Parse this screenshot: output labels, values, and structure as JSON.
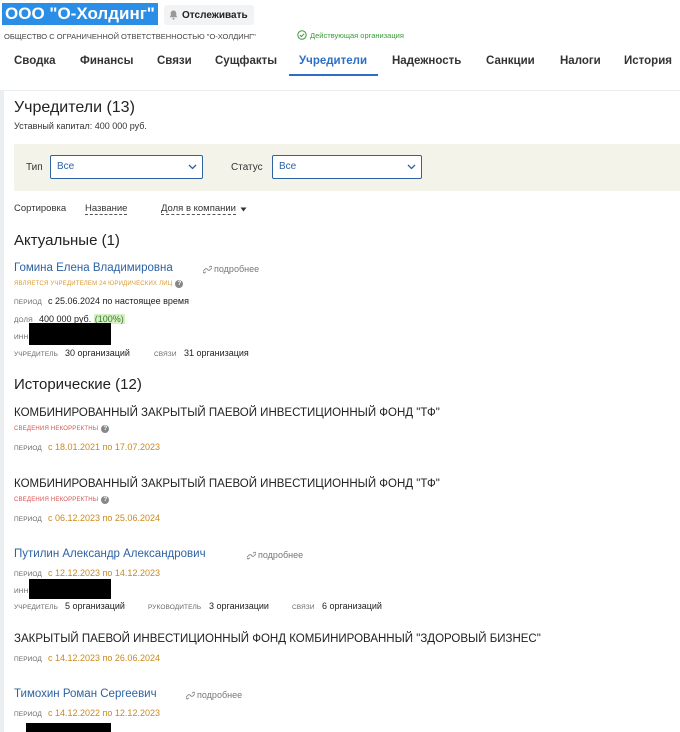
{
  "header": {
    "company_name": "ООО \"О-Холдинг\"",
    "track_label": "Отслеживать",
    "legal_name": "ОБЩЕСТВО С ОГРАНИЧЕННОЙ ОТВЕТСТВЕННОСТЬЮ \"О-ХОЛДИНГ\"",
    "status": "Действующая организация",
    "status_color": "#3c9a3c",
    "brand_color": "#2a8ee6"
  },
  "tabs": [
    {
      "label": "Сводка"
    },
    {
      "label": "Финансы"
    },
    {
      "label": "Связи"
    },
    {
      "label": "Сущфакты"
    },
    {
      "label": "Учредители",
      "active": true
    },
    {
      "label": "Надежность"
    },
    {
      "label": "Санкции"
    },
    {
      "label": "Налоги"
    },
    {
      "label": "История"
    }
  ],
  "founders": {
    "title": "Учредители (13)",
    "capital": "Уставный капитал: 400 000 руб.",
    "filters": {
      "type_label": "Тип",
      "type_value": "Все",
      "status_label": "Статус",
      "status_value": "Все"
    },
    "sort": {
      "label": "Сортировка",
      "option1": "Название",
      "option2": "Доля в компании"
    },
    "current_title": "Актуальные (1)",
    "current": [
      {
        "name": "Гомина Елена Владимировна",
        "more": "подробнее",
        "note": "ЯВЛЯЕТСЯ УЧРЕДИТЕЛЕМ 24 ЮРИДИЧЕСКИХ ЛИЦ",
        "period_label": "ПЕРИОД",
        "period": "с 25.06.2024 по настоящее время",
        "share_label": "ДОЛЯ",
        "share_value": "400 000 руб.",
        "share_pct": "(100%)",
        "inn_label": "ИНН",
        "founder_label": "УЧРЕДИТЕЛЬ",
        "founder_link": "30 организаций",
        "links_label": "СВЯЗИ",
        "links_link": "31 организация"
      }
    ],
    "historical_title": "Исторические (12)",
    "historical": [
      {
        "name": "КОМБИНИРОВАННЫЙ ЗАКРЫТЫЙ ПАЕВОЙ ИНВЕСТИЦИОННЫЙ ФОНД \"ТФ\"",
        "warning": "СВЕДЕНИЯ НЕКОРРЕКТНЫ",
        "period_label": "ПЕРИОД",
        "period": "с 18.01.2021 по 17.07.2023"
      },
      {
        "name": "КОМБИНИРОВАННЫЙ ЗАКРЫТЫЙ ПАЕВОЙ ИНВЕСТИЦИОННЫЙ ФОНД \"ТФ\"",
        "warning": "СВЕДЕНИЯ НЕКОРРЕКТНЫ",
        "period_label": "ПЕРИОД",
        "period": "с 06.12.2023 по 25.06.2024"
      },
      {
        "name": "Путилин Александр Александрович",
        "more": "подробнее",
        "period_label": "ПЕРИОД",
        "period": "с 12.12.2023 по 14.12.2023",
        "inn_label": "ИНН",
        "founder_label": "УЧРЕДИТЕЛЬ",
        "founder_link": "5 организаций",
        "head_label": "РУКОВОДИТЕЛЬ",
        "head_link": "3 организации",
        "links_label": "СВЯЗИ",
        "links_link": "6 организаций"
      },
      {
        "name": "ЗАКРЫТЫЙ ПАЕВОЙ ИНВЕСТИЦИОННЫЙ ФОНД КОМБИНИРОВАННЫЙ \"ЗДОРОВЫЙ БИЗНЕС\"",
        "period_label": "ПЕРИОД",
        "period": "с 14.12.2023 по 26.06.2024"
      },
      {
        "name": "Тимохин Роман Сергеевич",
        "more": "подробнее",
        "period_label": "ПЕРИОД",
        "period": "с 14.12.2022 по 12.12.2023"
      }
    ]
  }
}
